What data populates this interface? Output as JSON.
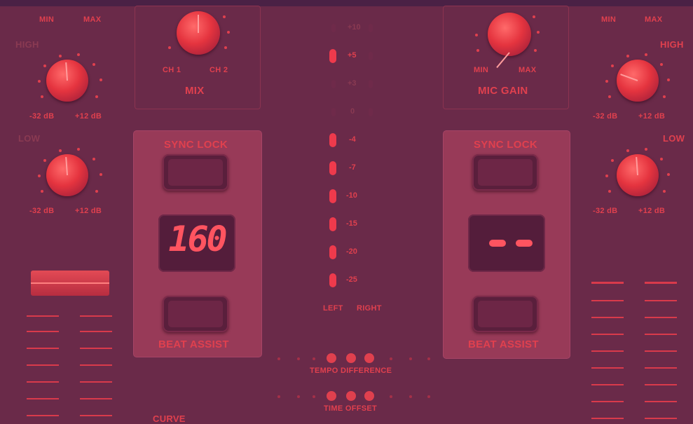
{
  "knobs": {
    "top_left": {
      "min": "MIN",
      "max": "MAX"
    },
    "high_left": {
      "title": "HIGH",
      "min": "-32 dB",
      "max": "+12 dB"
    },
    "low_left": {
      "title": "LOW",
      "min": "-32 dB",
      "max": "+12 dB"
    },
    "mix": {
      "title": "MIX",
      "left": "CH 1",
      "right": "CH 2"
    },
    "mic_gain": {
      "title": "MIC GAIN",
      "min": "MIN",
      "max": "MAX"
    },
    "top_right": {
      "min": "MIN",
      "max": "MAX"
    },
    "high_right": {
      "title": "HIGH",
      "min": "-32 dB",
      "max": "+12 dB"
    },
    "low_right": {
      "title": "LOW",
      "min": "-32 dB",
      "max": "+12 dB"
    }
  },
  "deck_left": {
    "sync_label": "SYNC LOCK",
    "bpm_display": "160",
    "beat_label": "BEAT ASSIST"
  },
  "deck_right": {
    "sync_label": "SYNC LOCK",
    "beat_label": "BEAT ASSIST"
  },
  "meter": {
    "scale": [
      "+10",
      "+5",
      "+3",
      "0",
      "-4",
      "-7",
      "-10",
      "-15",
      "-20",
      "-25"
    ],
    "channel_left": "LEFT",
    "channel_right": "RIGHT",
    "active_from_index": 4
  },
  "tempo_difference_label": "TEMPO DIFFERENCE",
  "time_offset_label": "TIME OFFSET",
  "curve_label": "CURVE",
  "colors": {
    "background": "#6a2a49",
    "accent": "#e2414f",
    "panel": "#983a58"
  }
}
